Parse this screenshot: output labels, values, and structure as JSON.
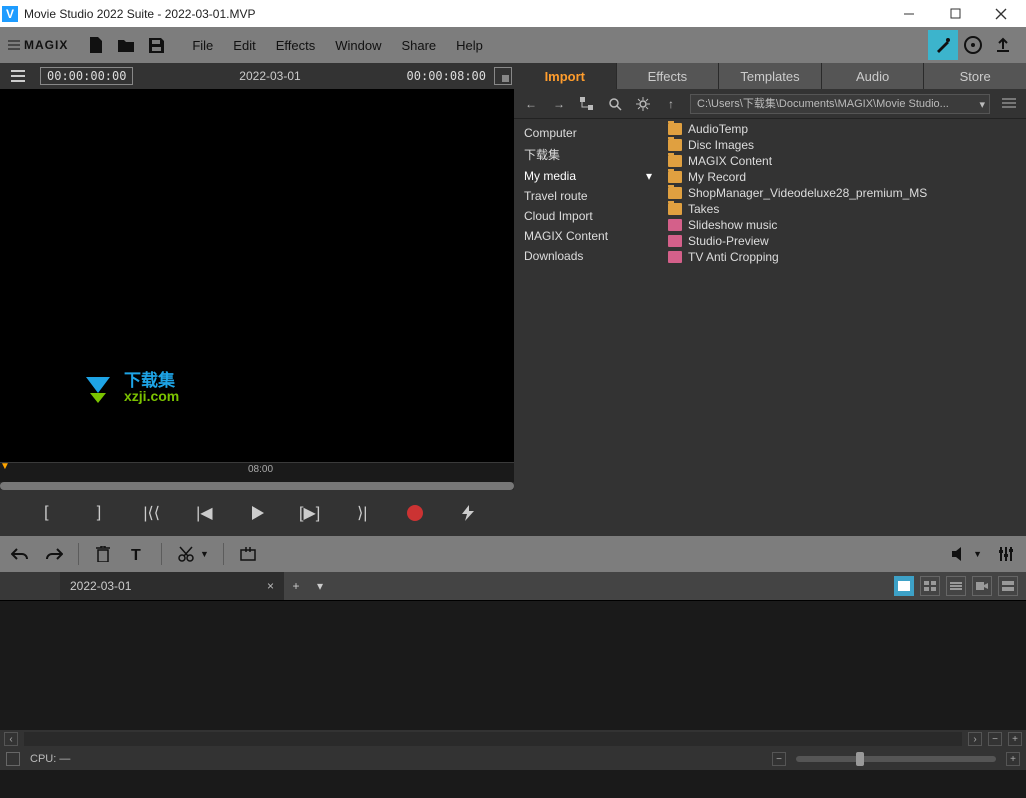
{
  "window": {
    "title": "Movie Studio 2022 Suite - 2022-03-01.MVP",
    "app_icon_letter": "V"
  },
  "brand": "MAGIX",
  "menu": {
    "file": "File",
    "edit": "Edit",
    "effects": "Effects",
    "window": "Window",
    "share": "Share",
    "help": "Help"
  },
  "preview": {
    "timecode": "00:00:00:00",
    "project_name": "2022-03-01",
    "duration": "00:00:08:00",
    "scrub_label": "08:00",
    "watermark_cn": "下载集",
    "watermark_url": "xzji.com"
  },
  "panel_tabs": {
    "import": "Import",
    "effects": "Effects",
    "templates": "Templates",
    "audio": "Audio",
    "store": "Store"
  },
  "path": "C:\\Users\\下载集\\Documents\\MAGIX\\Movie Studio...",
  "tree": {
    "computer": "Computer",
    "user": "下载集",
    "my_media": "My media",
    "travel_route": "Travel route",
    "cloud_import": "Cloud Import",
    "magix_content": "MAGIX Content",
    "downloads": "Downloads"
  },
  "files": [
    {
      "name": "AudioTemp",
      "type": "folder"
    },
    {
      "name": "Disc Images",
      "type": "folder"
    },
    {
      "name": "MAGIX Content",
      "type": "folder"
    },
    {
      "name": "My Record",
      "type": "folder"
    },
    {
      "name": "ShopManager_Videodeluxe28_premium_MS",
      "type": "folder"
    },
    {
      "name": "Takes",
      "type": "folder"
    },
    {
      "name": "Slideshow music",
      "type": "item"
    },
    {
      "name": "Studio-Preview",
      "type": "item"
    },
    {
      "name": "TV Anti Cropping",
      "type": "item"
    }
  ],
  "timeline_tab": "2022-03-01",
  "status": {
    "cpu": "CPU: —"
  }
}
